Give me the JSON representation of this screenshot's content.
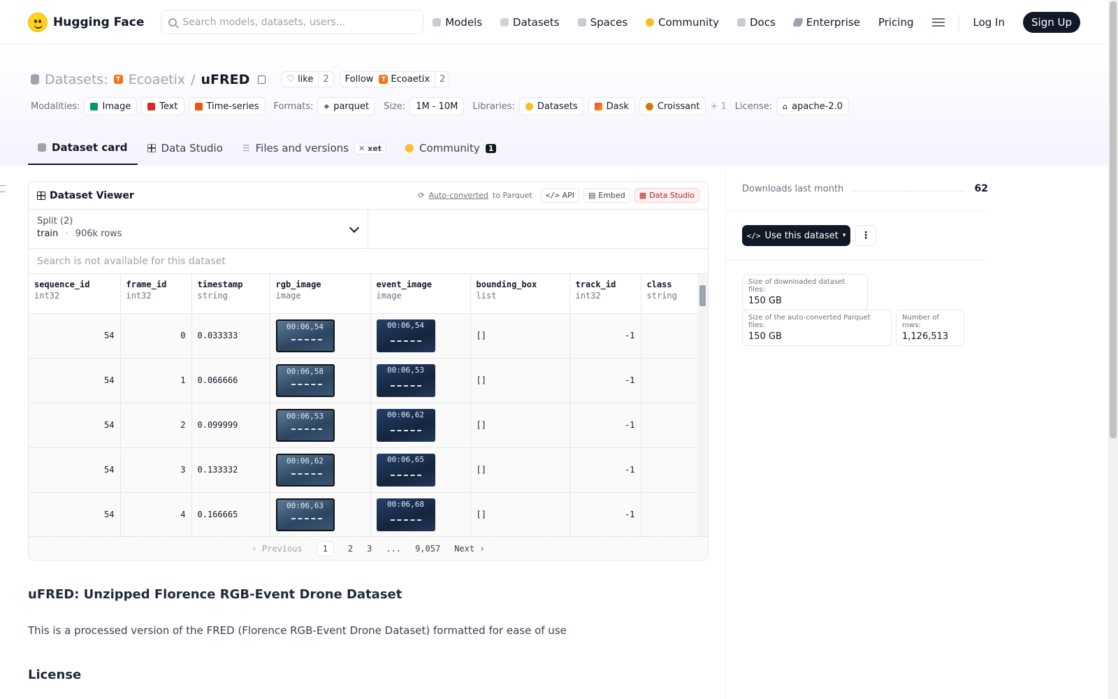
{
  "nav": {
    "brand": "Hugging Face",
    "search_placeholder": "Search models, datasets, users...",
    "links": [
      "Models",
      "Datasets",
      "Spaces",
      "Community",
      "Docs",
      "Enterprise",
      "Pricing"
    ],
    "login": "Log In",
    "signup": "Sign Up"
  },
  "header": {
    "section": "Datasets:",
    "org": "Ecoaetix",
    "org_initial": "T",
    "sep": "/",
    "repo": "uFRED",
    "like_label": "like",
    "like_count": "2",
    "follow_label": "Follow",
    "follow_org": "Ecoaetix",
    "follow_count": "2",
    "modalities_label": "Modalities:",
    "modalities": [
      "Image",
      "Text",
      "Time-series"
    ],
    "formats_label": "Formats:",
    "format": "parquet",
    "size_label": "Size:",
    "size": "1M - 10M",
    "libraries_label": "Libraries:",
    "libraries": [
      "Datasets",
      "Dask",
      "Croissant"
    ],
    "libraries_more": "+ 1",
    "license_label": "License:",
    "license": "apache-2.0"
  },
  "tabs": {
    "dataset_card": "Dataset card",
    "data_studio": "Data Studio",
    "files": "Files and versions",
    "xet": "xet",
    "community": "Community",
    "community_count": "1"
  },
  "viewer": {
    "title": "Dataset Viewer",
    "auto_converted": "Auto-converted",
    "to_parquet": "to Parquet",
    "api": "API",
    "embed": "Embed",
    "data_studio": "Data Studio",
    "split_label": "Split (2)",
    "split_name": "train",
    "split_dot": "·",
    "split_rows": "906k rows",
    "search_na": "Search is not available for this dataset",
    "columns": [
      {
        "name": "sequence_id",
        "type": "int32"
      },
      {
        "name": "frame_id",
        "type": "int32"
      },
      {
        "name": "timestamp",
        "type": "string"
      },
      {
        "name": "rgb_image",
        "type": "image"
      },
      {
        "name": "event_image",
        "type": "image"
      },
      {
        "name": "bounding_box",
        "type": "list"
      },
      {
        "name": "track_id",
        "type": "int32"
      },
      {
        "name": "class",
        "type": "string"
      }
    ],
    "rows": [
      {
        "sequence_id": "54",
        "frame_id": "0",
        "timestamp": "0.033333",
        "rgb": "00:06,54",
        "event": "00:06,54",
        "bbox": "[]",
        "track_id": "-1"
      },
      {
        "sequence_id": "54",
        "frame_id": "1",
        "timestamp": "0.066666",
        "rgb": "00:06,58",
        "event": "00:06,53",
        "bbox": "[]",
        "track_id": "-1"
      },
      {
        "sequence_id": "54",
        "frame_id": "2",
        "timestamp": "0.099999",
        "rgb": "00:06,53",
        "event": "00:06,62",
        "bbox": "[]",
        "track_id": "-1"
      },
      {
        "sequence_id": "54",
        "frame_id": "3",
        "timestamp": "0.133332",
        "rgb": "00:06,62",
        "event": "00:06,65",
        "bbox": "[]",
        "track_id": "-1"
      },
      {
        "sequence_id": "54",
        "frame_id": "4",
        "timestamp": "0.166665",
        "rgb": "00:06,63",
        "event": "00:06,68",
        "bbox": "[]",
        "track_id": "-1"
      }
    ],
    "pager": {
      "previous": "Previous",
      "pages": [
        "1",
        "2",
        "3",
        "...",
        "9,057"
      ],
      "next": "Next"
    }
  },
  "card": {
    "title": "uFRED: Unzipped Florence RGB-Event Drone Dataset",
    "description": "This is a processed version of the FRED (Florence RGB-Event Drone Dataset) formatted for ease of use",
    "license_heading": "License"
  },
  "sidebar": {
    "downloads_label": "Downloads last month",
    "downloads": "62",
    "use_button": "Use this dataset",
    "size_files_label": "Size of downloaded dataset files:",
    "size_files": "150 GB",
    "size_parquet_label": "Size of the auto-converted Parquet files:",
    "size_parquet": "150 GB",
    "rows_label": "Number of rows:",
    "rows": "1,126,513"
  },
  "colors": {
    "accent": "#111827",
    "org": "#f97316",
    "community": "#fbbf24"
  }
}
